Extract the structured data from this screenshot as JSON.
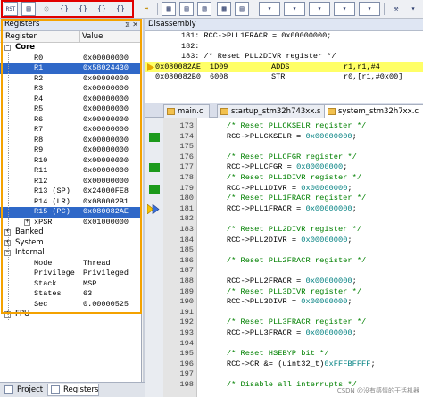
{
  "toolbar": {
    "buttons": [
      {
        "name": "reset-button",
        "label": "RST"
      },
      {
        "name": "run-button",
        "label": ""
      },
      {
        "name": "stop-button",
        "label": ""
      },
      {
        "name": "step-into-button",
        "label": "{}"
      },
      {
        "name": "step-over-button",
        "label": "{}"
      },
      {
        "name": "step-out-button",
        "label": "{}"
      },
      {
        "name": "run-to-cursor-button",
        "label": "{}"
      }
    ]
  },
  "registers": {
    "title": "Registers",
    "col_register": "Register",
    "col_value": "Value",
    "rows": [
      {
        "name": "Core",
        "value": "",
        "kind": "group",
        "toggle": "−"
      },
      {
        "name": "R0",
        "value": "0x00000000"
      },
      {
        "name": "R1",
        "value": "0x58024430",
        "selected": true
      },
      {
        "name": "R2",
        "value": "0x00000000"
      },
      {
        "name": "R3",
        "value": "0x00000000"
      },
      {
        "name": "R4",
        "value": "0x00000000"
      },
      {
        "name": "R5",
        "value": "0x00000000"
      },
      {
        "name": "R6",
        "value": "0x00000000"
      },
      {
        "name": "R7",
        "value": "0x00000000"
      },
      {
        "name": "R8",
        "value": "0x00000000"
      },
      {
        "name": "R9",
        "value": "0x00000000"
      },
      {
        "name": "R10",
        "value": "0x00000000"
      },
      {
        "name": "R11",
        "value": "0x00000000"
      },
      {
        "name": "R12",
        "value": "0x00000000"
      },
      {
        "name": "R13 (SP)",
        "value": "0x24000FE8"
      },
      {
        "name": "R14 (LR)",
        "value": "0x080002B1"
      },
      {
        "name": "R15 (PC)",
        "value": "0x080082AE",
        "selected": true
      },
      {
        "name": "xPSR",
        "value": "0x01000000",
        "toggle": "+"
      },
      {
        "name": "Banked",
        "value": "",
        "kind": "group",
        "toggle": "+"
      },
      {
        "name": "System",
        "value": "",
        "kind": "group",
        "toggle": "+"
      },
      {
        "name": "Internal",
        "value": "",
        "kind": "group",
        "toggle": "−"
      },
      {
        "name": "Mode",
        "value": "Thread"
      },
      {
        "name": "Privilege",
        "value": "Privileged"
      },
      {
        "name": "Stack",
        "value": "MSP"
      },
      {
        "name": "States",
        "value": "63"
      },
      {
        "name": "Sec",
        "value": "0.00000525"
      },
      {
        "name": "FPU",
        "value": "",
        "kind": "group",
        "toggle": "+"
      }
    ]
  },
  "bottom_tabs": [
    {
      "label": "Project"
    },
    {
      "label": "Registers"
    }
  ],
  "disassembly": {
    "title": "Disassembly",
    "lines": [
      {
        "text": "181:     RCC->PLL1FRACR = 0x00000000;"
      },
      {
        "text": "182:"
      },
      {
        "text": "183:     /* Reset PLL2DIVR register */"
      },
      {
        "addr": "0x080082AE",
        "op": "1D09",
        "mn": "ADDS",
        "args": "r1,r1,#4",
        "current": true
      },
      {
        "addr": "0x080082B0",
        "op": "6008",
        "mn": "STR",
        "args": "r0,[r1,#0x00]"
      }
    ]
  },
  "file_tabs": [
    {
      "label": "main.c"
    },
    {
      "label": "startup_stm32h743xx.s"
    },
    {
      "label": "system_stm32h7xx.c",
      "active": true
    }
  ],
  "editor": {
    "lines": [
      {
        "n": "173",
        "code": "    /* Reset PLLCKSELR register */",
        "cls": "c-cm"
      },
      {
        "n": "174",
        "code": "    RCC->PLLCKSELR = 0x00000000;",
        "mark": true
      },
      {
        "n": "175",
        "code": ""
      },
      {
        "n": "176",
        "code": "    /* Reset PLLCFGR register */",
        "cls": "c-cm"
      },
      {
        "n": "177",
        "code": "    RCC->PLLCFGR = 0x00000000;",
        "mark": true
      },
      {
        "n": "178",
        "code": "    /* Reset PLL1DIVR register */",
        "cls": "c-cm"
      },
      {
        "n": "179",
        "code": "    RCC->PLL1DIVR = 0x00000000;",
        "mark": true
      },
      {
        "n": "180",
        "code": "    /* Reset PLL1FRACR register */",
        "cls": "c-cm"
      },
      {
        "n": "181",
        "code": "    RCC->PLL1FRACR = 0x00000000;",
        "pc": true
      },
      {
        "n": "182",
        "code": ""
      },
      {
        "n": "183",
        "code": "    /* Reset PLL2DIVR register */",
        "cls": "c-cm"
      },
      {
        "n": "184",
        "code": "    RCC->PLL2DIVR = 0x00000000;"
      },
      {
        "n": "185",
        "code": ""
      },
      {
        "n": "186",
        "code": "    /* Reset PLL2FRACR register */",
        "cls": "c-cm"
      },
      {
        "n": "187",
        "code": ""
      },
      {
        "n": "188",
        "code": "    RCC->PLL2FRACR = 0x00000000;"
      },
      {
        "n": "189",
        "code": "    /* Reset PLL3DIVR register */",
        "cls": "c-cm"
      },
      {
        "n": "190",
        "code": "    RCC->PLL3DIVR = 0x00000000;"
      },
      {
        "n": "191",
        "code": ""
      },
      {
        "n": "192",
        "code": "    /* Reset PLL3FRACR register */",
        "cls": "c-cm"
      },
      {
        "n": "193",
        "code": "    RCC->PLL3FRACR = 0x00000000;"
      },
      {
        "n": "194",
        "code": ""
      },
      {
        "n": "195",
        "code": "    /* Reset HSEBYP bit */",
        "cls": "c-cm"
      },
      {
        "n": "196",
        "code": "    RCC->CR &= (uint32_t)0xFFFBFFFF;"
      },
      {
        "n": "197",
        "code": ""
      },
      {
        "n": "198",
        "code": "    /* Disable all interrupts */",
        "cls": "c-cm"
      }
    ]
  },
  "watermark": "CSDN @没有感情的干活机器"
}
